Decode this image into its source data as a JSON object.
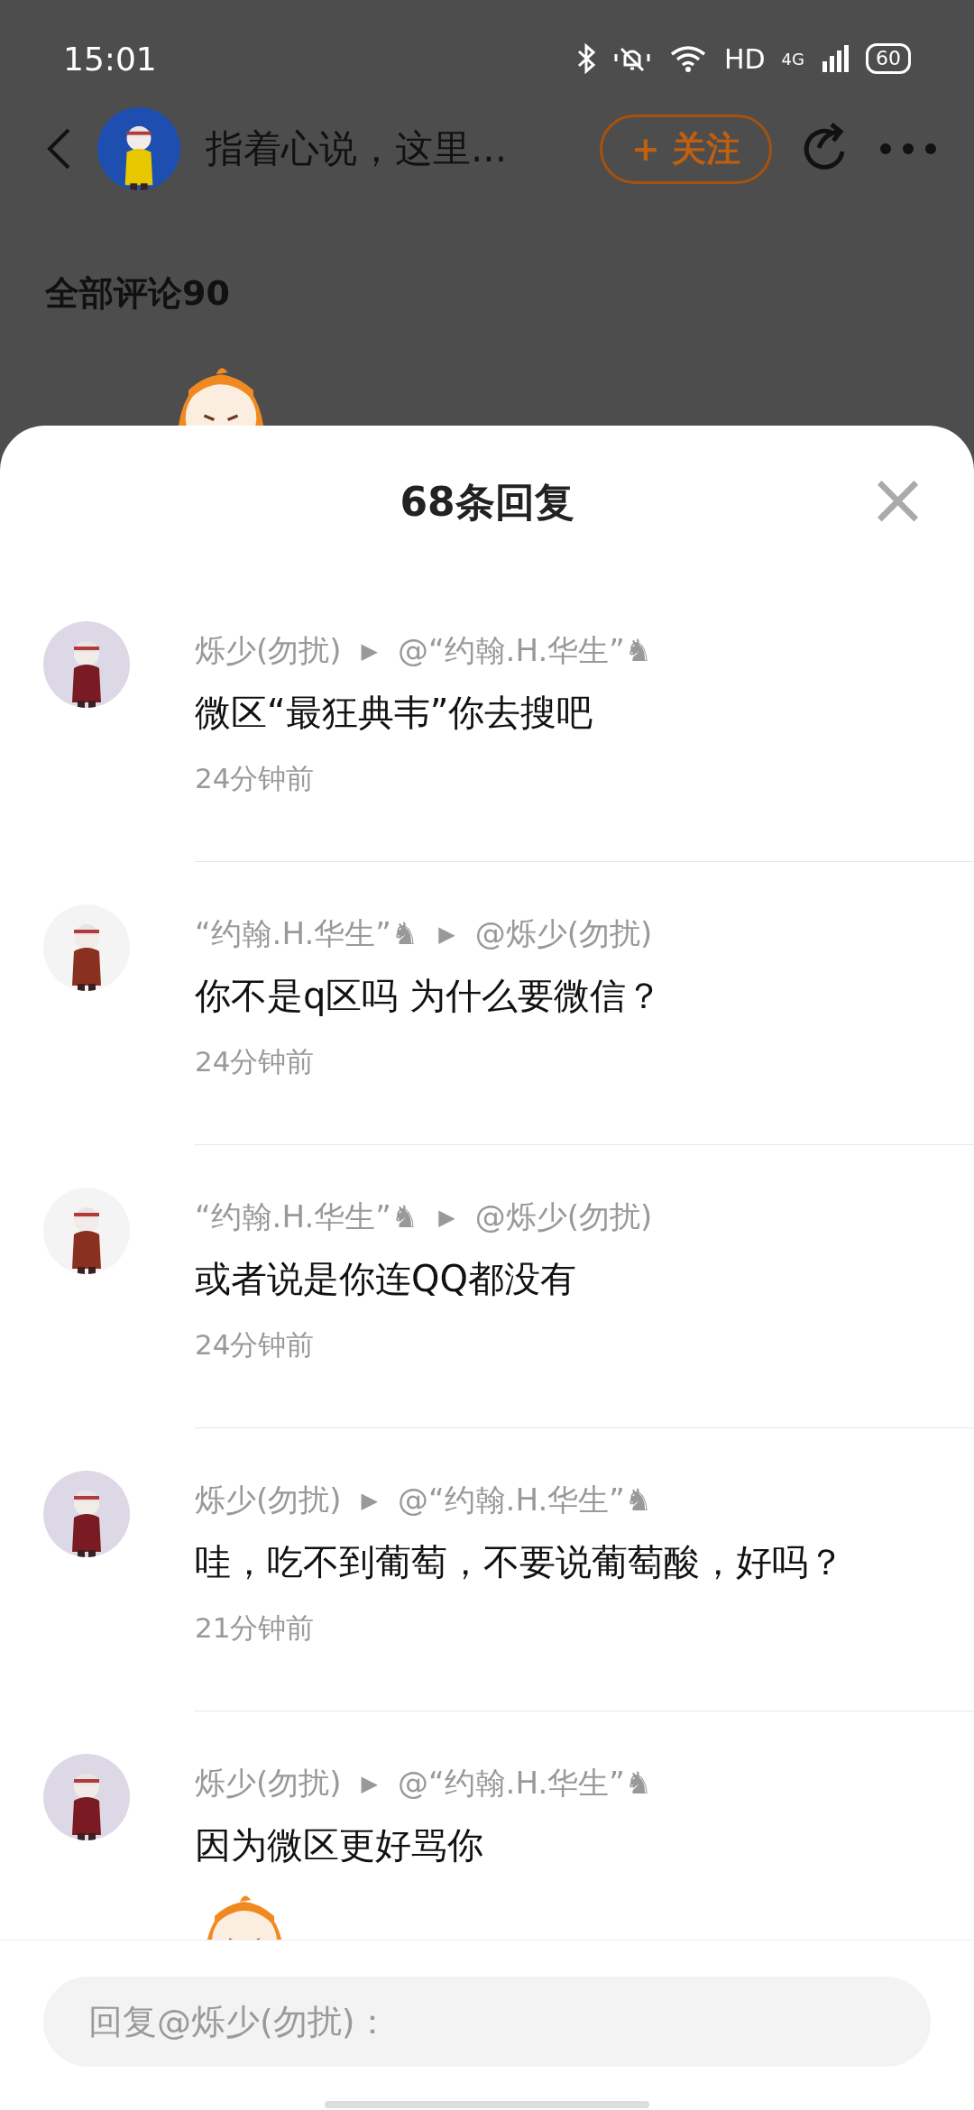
{
  "status_bar": {
    "time": "15:01",
    "network_label": "HD",
    "cellular_label": "4G",
    "battery": "60"
  },
  "background_page": {
    "header": {
      "title": "指着心说，这里...",
      "follow_button": "+ 关注"
    },
    "comments_heading": "全部评论90"
  },
  "reply_sheet": {
    "title": "68条回复",
    "close": "×",
    "replies": [
      {
        "author": "烁少(勿扰)",
        "arrow": "▶",
        "target": "@“约翰.H.华生”♞",
        "text": "微区“最狂典韦”你去搜吧",
        "time": "24分钟前",
        "sticker": false
      },
      {
        "author": "“约翰.H.华生”♞",
        "arrow": "▶",
        "target": "@烁少(勿扰)",
        "text": "你不是q区吗 为什么要微信？",
        "time": "24分钟前",
        "sticker": false
      },
      {
        "author": "“约翰.H.华生”♞",
        "arrow": "▶",
        "target": "@烁少(勿扰)",
        "text": "或者说是你连QQ都没有",
        "time": "24分钟前",
        "sticker": false
      },
      {
        "author": "烁少(勿扰)",
        "arrow": "▶",
        "target": "@“约翰.H.华生”♞",
        "text": "哇，吃不到葡萄，不要说葡萄酸，好吗？",
        "time": "21分钟前",
        "sticker": false
      },
      {
        "author": "烁少(勿扰)",
        "arrow": "▶",
        "target": "@“约翰.H.华生”♞",
        "text": "因为微区更好骂你",
        "sticker": true
      }
    ],
    "reply_input": {
      "placeholder": "回复@烁少(勿扰)："
    }
  }
}
